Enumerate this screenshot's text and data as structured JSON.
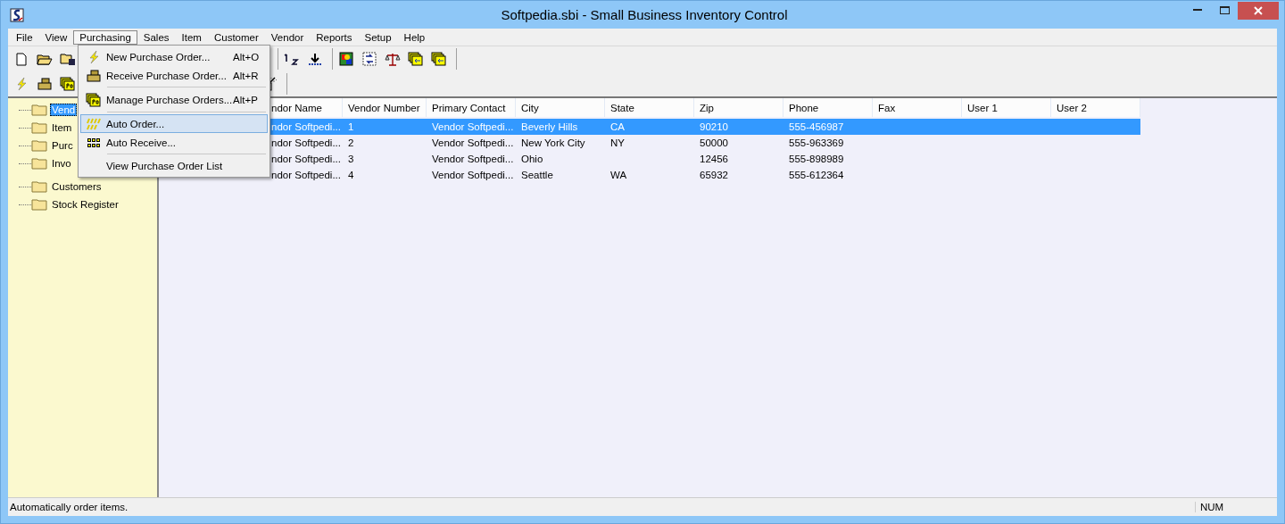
{
  "window": {
    "title": "Softpedia.sbi - Small Business Inventory Control"
  },
  "menu_bar": [
    {
      "label": "File",
      "selected": false
    },
    {
      "label": "View",
      "selected": false
    },
    {
      "label": "Purchasing",
      "selected": true
    },
    {
      "label": "Sales",
      "selected": false
    },
    {
      "label": "Item",
      "selected": false
    },
    {
      "label": "Customer",
      "selected": false
    },
    {
      "label": "Vendor",
      "selected": false
    },
    {
      "label": "Reports",
      "selected": false
    },
    {
      "label": "Setup",
      "selected": false
    },
    {
      "label": "Help",
      "selected": false
    }
  ],
  "open_menu": [
    {
      "kind": "item",
      "label": "New Purchase Order...",
      "shortcut": "Alt+O",
      "selected": false
    },
    {
      "kind": "item",
      "label": "Receive Purchase Order...",
      "shortcut": "Alt+R",
      "selected": false
    },
    {
      "kind": "separator"
    },
    {
      "kind": "item",
      "label": "Manage Purchase Orders...",
      "shortcut": "Alt+P",
      "selected": false
    },
    {
      "kind": "separator"
    },
    {
      "kind": "item",
      "label": "Auto Order...",
      "selected": true
    },
    {
      "kind": "item",
      "label": "Auto Receive...",
      "selected": false
    },
    {
      "kind": "separator"
    },
    {
      "kind": "item",
      "label": "View Purchase Order List",
      "selected": false
    }
  ],
  "tree": [
    {
      "label": "Vend",
      "selected": true
    },
    {
      "label": "Item",
      "selected": false
    },
    {
      "label": "Purc",
      "selected": false
    },
    {
      "label": "Invo",
      "selected": false
    },
    {
      "label": "Customers",
      "selected": false
    },
    {
      "label": "Stock Register",
      "selected": false
    }
  ],
  "table": {
    "columns": [
      "",
      "ndor Name",
      "Vendor Number",
      "Primary Contact",
      "City",
      "State",
      "Zip",
      "Phone",
      "Fax",
      "User 1",
      "User 2"
    ],
    "rows": [
      {
        "selected": true,
        "cells": [
          "",
          "ndor Softpedi...",
          "1",
          "Vendor Softpedi...",
          "Beverly Hills",
          "CA",
          "90210",
          "555-456987",
          "",
          "",
          ""
        ]
      },
      {
        "selected": false,
        "cells": [
          "",
          "ndor Softpedi...",
          "2",
          "Vendor Softpedi...",
          "New York City",
          "NY",
          "50000",
          "555-963369",
          "",
          "",
          ""
        ]
      },
      {
        "selected": false,
        "cells": [
          "",
          "ndor Softpedi...",
          "3",
          "Vendor Softpedi...",
          "Ohio",
          "",
          "12456",
          "555-898989",
          "",
          "",
          ""
        ]
      },
      {
        "selected": false,
        "cells": [
          "",
          "ndor Softpedi...",
          "4",
          "Vendor Softpedi...",
          "Seattle",
          "WA",
          "65932",
          "555-612364",
          "",
          "",
          ""
        ]
      }
    ]
  },
  "status_bar": {
    "message": "Automatically order items.",
    "indicator": "NUM"
  }
}
